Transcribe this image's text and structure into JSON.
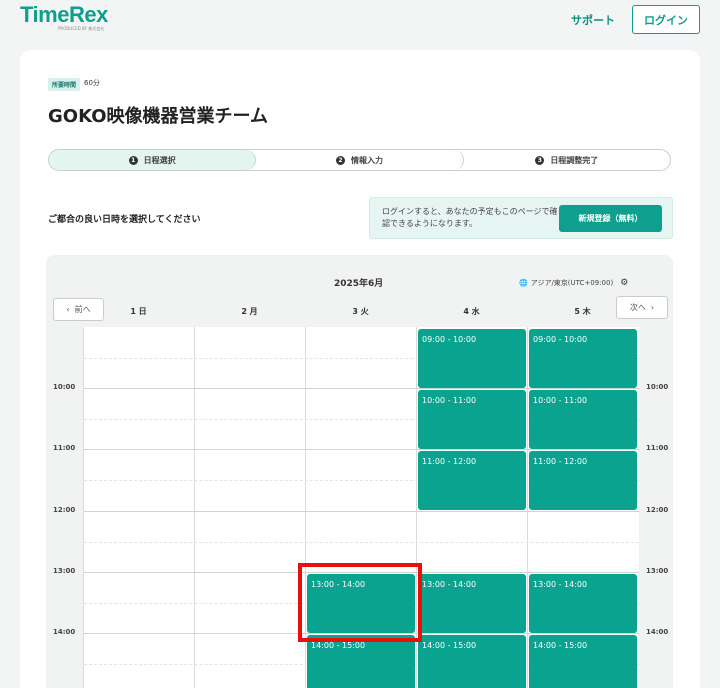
{
  "header": {
    "logo": "TimeRex",
    "logo_sub": "PRODUCED BY 株式会社",
    "support_link": "サポート",
    "login_button": "ログイン"
  },
  "event": {
    "duration_label": "所要時間",
    "duration_value": "60分",
    "title": "GOKO映像機器営業チーム"
  },
  "steps": [
    {
      "num": "1",
      "label": "日程選択"
    },
    {
      "num": "2",
      "label": "情報入力"
    },
    {
      "num": "3",
      "label": "日程調整完了"
    }
  ],
  "instruction": "ご都合の良い日時を選択してください",
  "login_notice": {
    "text": "ログインすると、あなたの予定もこのページで確認できるようになります。",
    "register_button": "新規登録（無料）"
  },
  "calendar": {
    "month": "2025年6月",
    "timezone": "アジア/東京(UTC+09:00)",
    "prev_button": "前へ",
    "next_button": "次へ",
    "days": [
      "1 日",
      "2 月",
      "3 火",
      "4 水",
      "5 木"
    ],
    "time_labels": [
      "10:00",
      "11:00",
      "12:00",
      "13:00",
      "14:00"
    ],
    "slots": {
      "day3": [
        "13:00 - 14:00",
        "14:00 - 15:00"
      ],
      "day4": [
        "09:00 - 10:00",
        "10:00 - 11:00",
        "11:00 - 12:00",
        "13:00 - 14:00",
        "14:00 - 15:00"
      ],
      "day5": [
        "09:00 - 10:00",
        "10:00 - 11:00",
        "11:00 - 12:00",
        "13:00 - 14:00",
        "14:00 - 15:00"
      ]
    }
  },
  "colors": {
    "brand": "#0e9f8e",
    "slot": "#0aa38f",
    "highlight": "#e8100c"
  }
}
